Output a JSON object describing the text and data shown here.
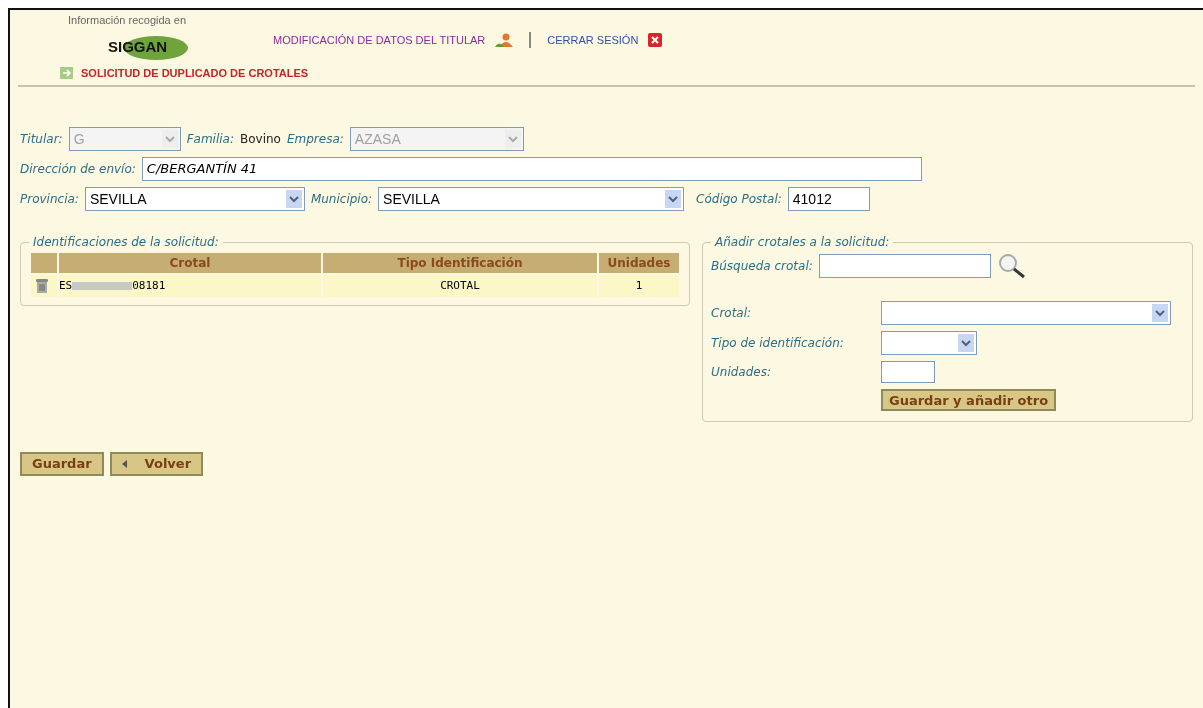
{
  "header": {
    "caption": "Información recogida en",
    "logo": "SIGGAN",
    "links": [
      {
        "label": "MODIFICACIÓN DE DATOS DEL TITULAR",
        "kind": "profile"
      },
      {
        "label": "CERRAR SESIÓN",
        "kind": "close"
      }
    ],
    "section": "SOLICITUD DE DUPLICADO DE CROTALES"
  },
  "form": {
    "titular": {
      "label": "Titular:",
      "value": "G",
      "disabled": true
    },
    "familia": {
      "label": "Familia:",
      "value": "Bovino"
    },
    "empresa": {
      "label": "Empresa:",
      "value": "AZASA",
      "disabled": true
    },
    "direccion": {
      "label": "Dirección de envío:",
      "value": "C/BERGANTÍN 41"
    },
    "provincia": {
      "label": "Provincia:",
      "value": "SEVILLA"
    },
    "municipio": {
      "label": "Municipio:",
      "value": "SEVILLA"
    },
    "codigo_postal": {
      "label": "Código Postal:",
      "value": "41012"
    }
  },
  "identificaciones": {
    "legend": "Identificaciones de la solicitud:",
    "columns": [
      "Crotal",
      "Tipo Identificación",
      "Unidades"
    ],
    "rows": [
      {
        "crotal_start": "ES",
        "crotal_end": "08181",
        "tipo": "CROTAL",
        "unidades": "1"
      }
    ]
  },
  "anadir": {
    "legend": "Añadir crotales a la solicitud:",
    "busqueda_label": "Búsqueda crotal:",
    "crotal_label": "Crotal:",
    "tipo_label": "Tipo de identificación:",
    "unidades_label": "Unidades:",
    "button": "Guardar y añadir otro"
  },
  "buttons": [
    {
      "label": "Guardar",
      "kind": "save"
    },
    {
      "label": "Volver",
      "kind": "back"
    }
  ]
}
